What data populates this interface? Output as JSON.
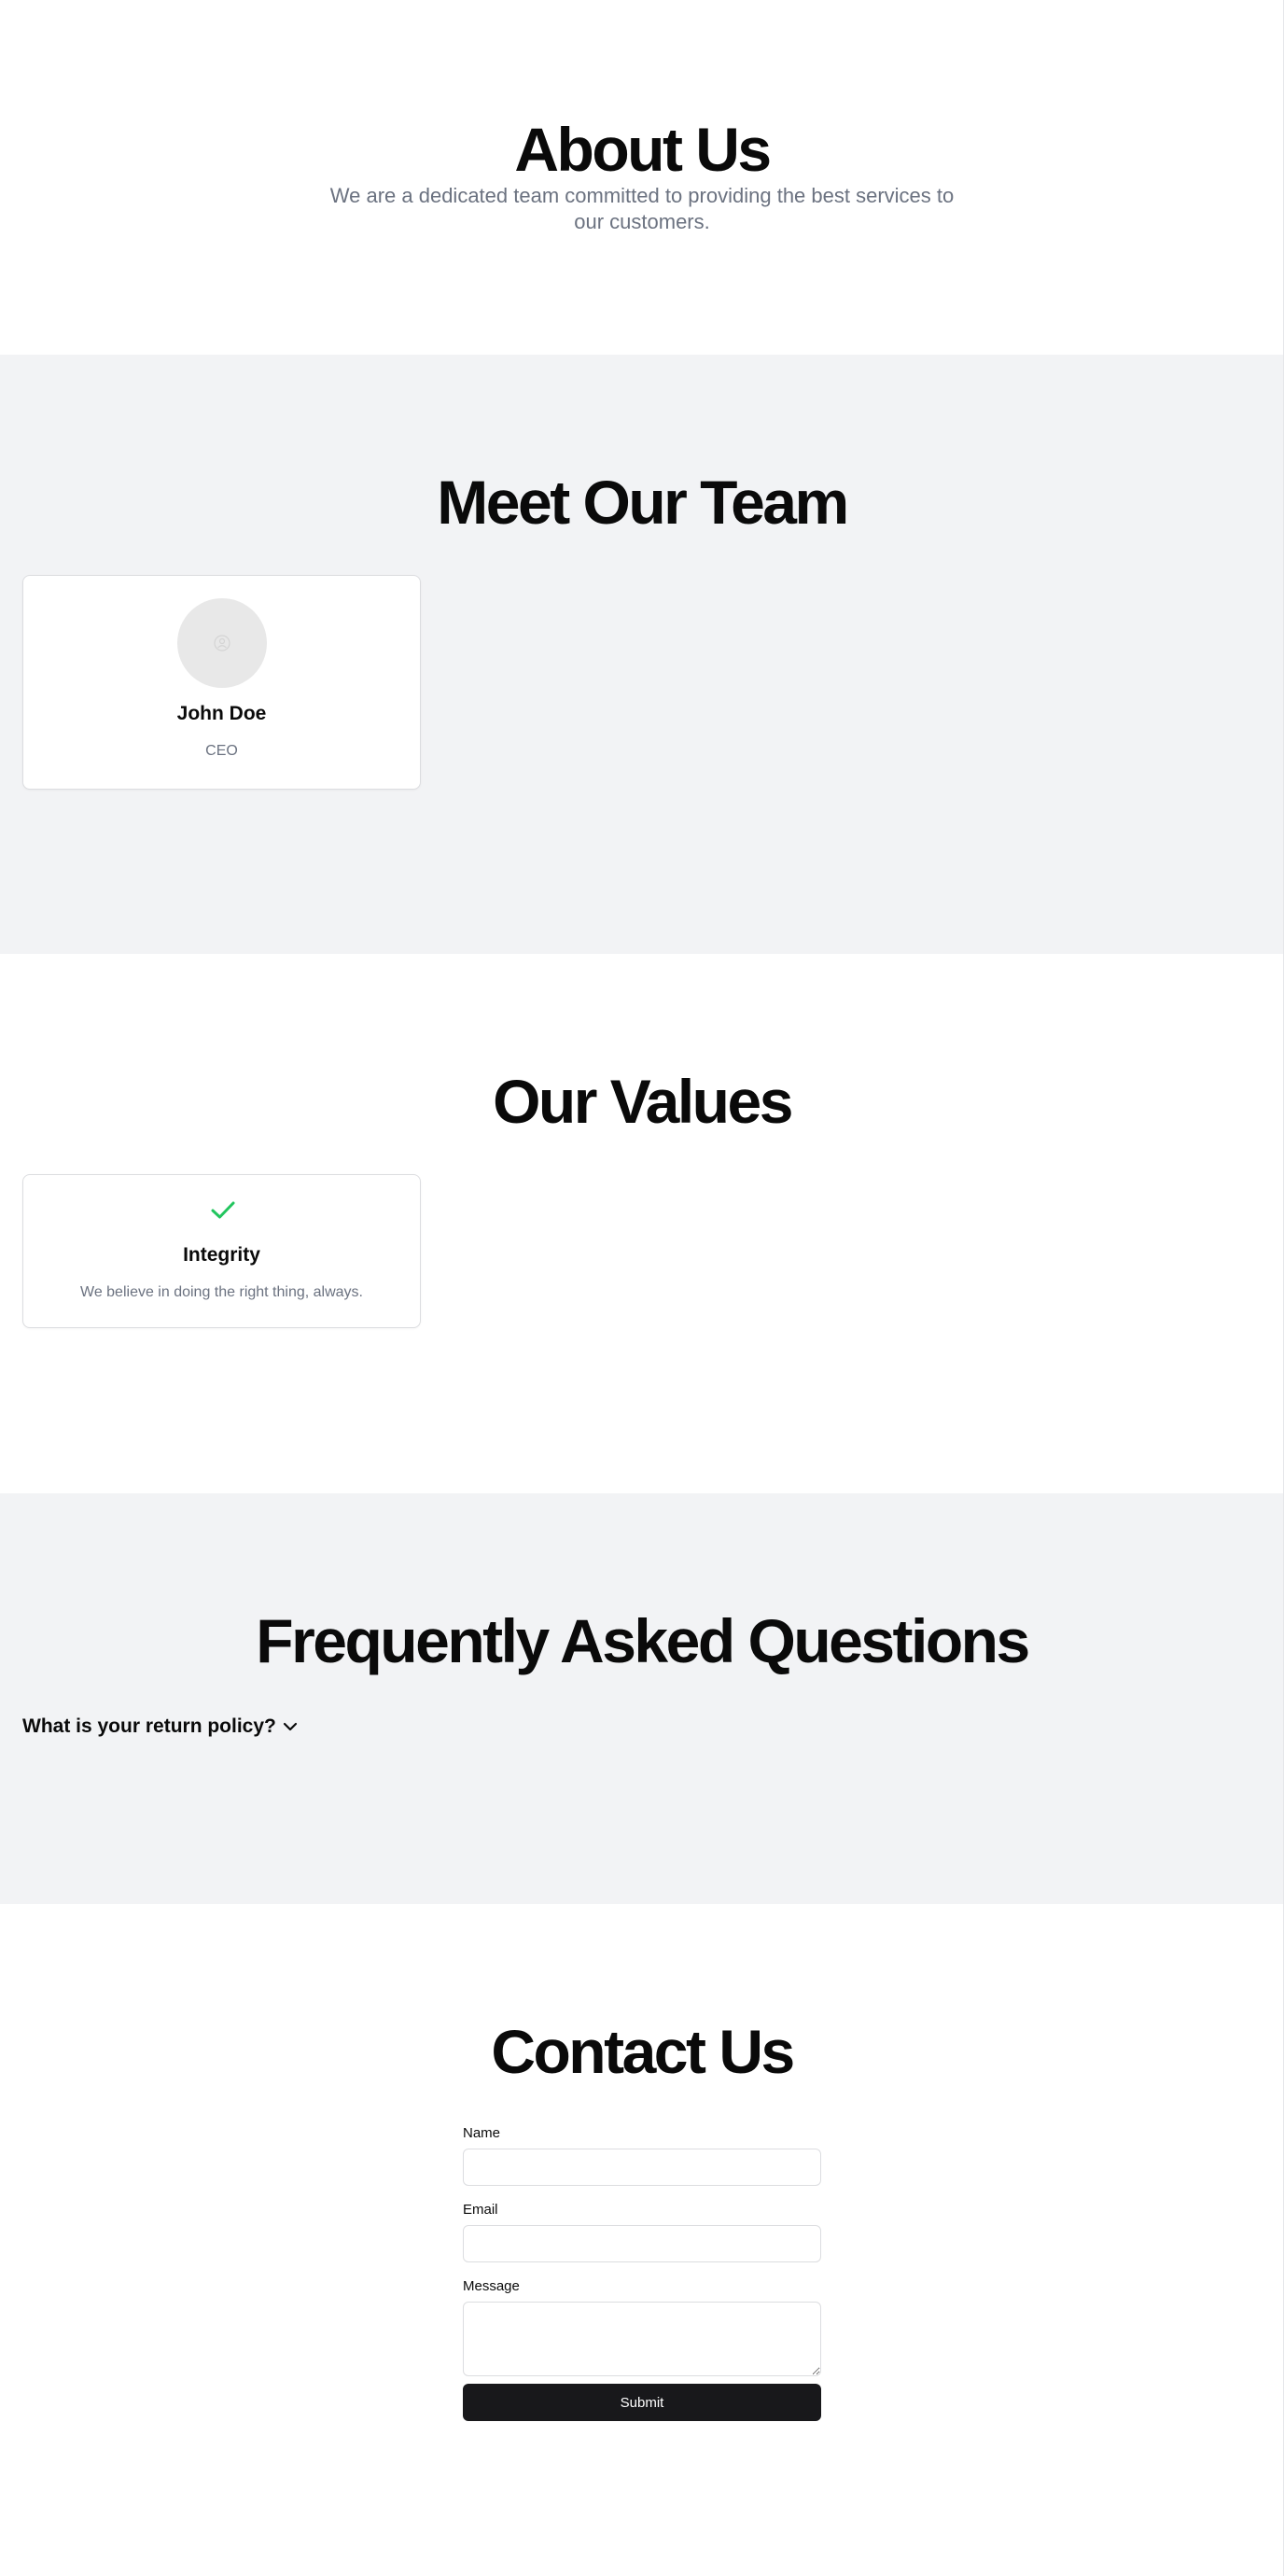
{
  "about": {
    "title": "About Us",
    "subtitle": "We are a dedicated team committed to providing the best services to our customers."
  },
  "team": {
    "title": "Meet Our Team",
    "members": [
      {
        "name": "John Doe",
        "role": "CEO",
        "avatar_icon": "user-placeholder-icon"
      }
    ]
  },
  "values": {
    "title": "Our Values",
    "items": [
      {
        "title": "Integrity",
        "description": "We believe in doing the right thing, always.",
        "icon": "check-icon",
        "icon_color": "#22c55e"
      }
    ]
  },
  "faq": {
    "title": "Frequently Asked Questions",
    "items": [
      {
        "question": "What is your return policy?",
        "icon": "chevron-down-icon"
      }
    ]
  },
  "contact": {
    "title": "Contact Us",
    "name_label": "Name",
    "name_value": "",
    "email_label": "Email",
    "email_value": "",
    "message_label": "Message",
    "message_value": "",
    "submit_label": "Submit"
  },
  "colors": {
    "background": "#ffffff",
    "section_alt": "#f2f3f5",
    "muted_text": "#6b7280",
    "button": "#18181b",
    "accent_green": "#22c55e"
  }
}
